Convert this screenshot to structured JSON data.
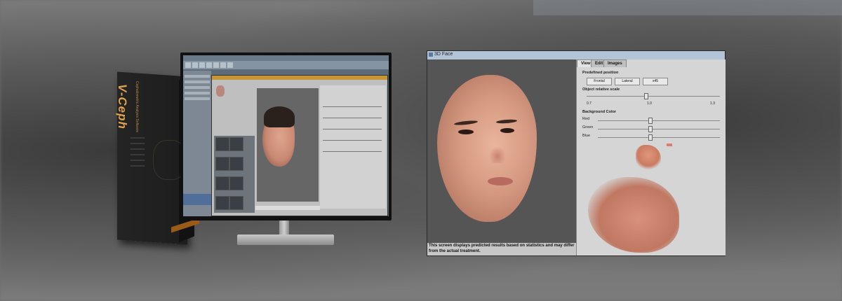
{
  "product_box": {
    "brand": "V-Ceph",
    "subtitle": "Cephalometric Analysis Software"
  },
  "predict_window": {
    "title": "3D Face",
    "tabs": [
      "View",
      "Edit",
      "Images"
    ],
    "predefined_position_label": "Predefined position",
    "position_buttons": [
      "Frontal",
      "Lateral",
      "x45"
    ],
    "object_scale_label": "Object relative scale",
    "scale_ticks": [
      "0.7",
      "1.0",
      "1.3"
    ],
    "background_color_label": "Background Color",
    "channels": [
      "Red",
      "Green",
      "Blue"
    ],
    "note": "This screen displays predicted results based on statistics and may differ from the actual treatment."
  }
}
